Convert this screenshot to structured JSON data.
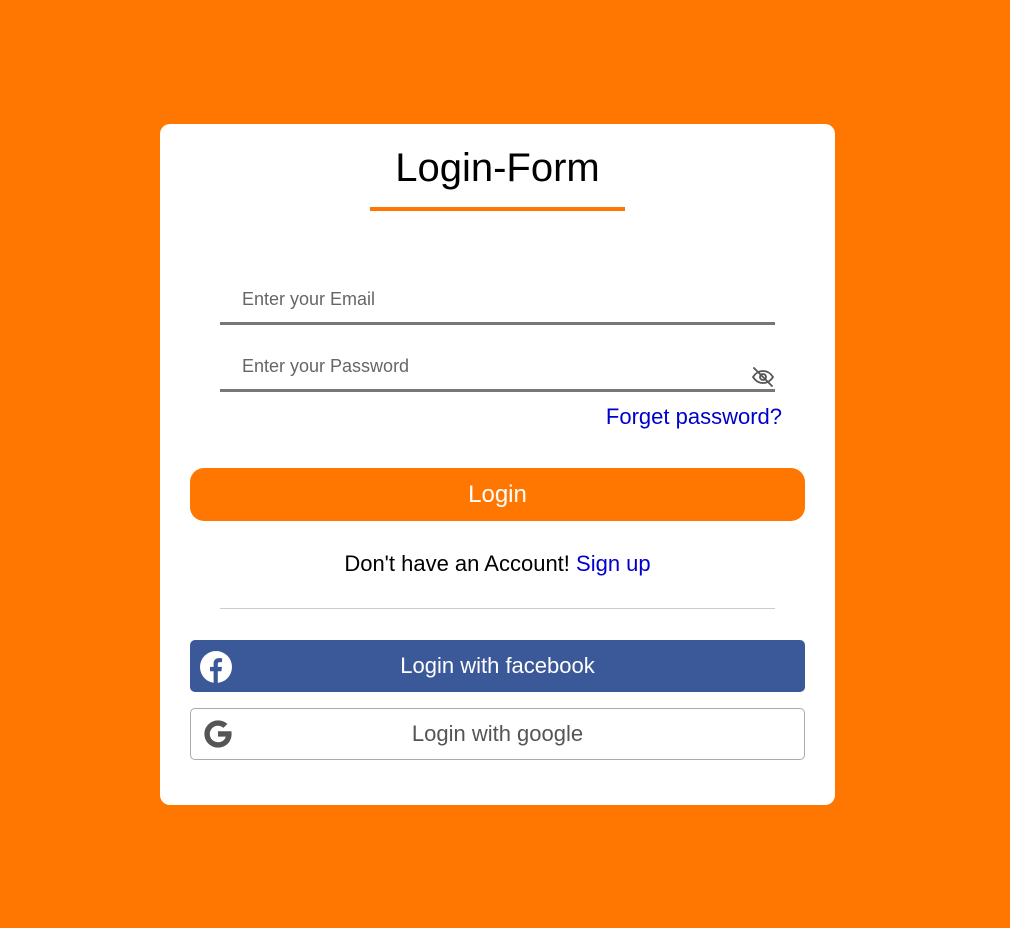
{
  "form": {
    "title": "Login-Form",
    "email_placeholder": "Enter your Email",
    "password_placeholder": "Enter your Password",
    "forgot_label": "Forget password?",
    "login_label": "Login",
    "signup_prompt": "Don't have an Account!",
    "signup_label": "Sign up"
  },
  "social": {
    "facebook_label": "Login with facebook",
    "google_label": "Login with google",
    "facebook_icon": "facebook-icon",
    "google_icon": "google-icon"
  },
  "colors": {
    "background": "#ff7700",
    "accent": "#ff7700",
    "link": "#0000cc",
    "facebook": "#3b5998",
    "card": "#ffffff"
  }
}
